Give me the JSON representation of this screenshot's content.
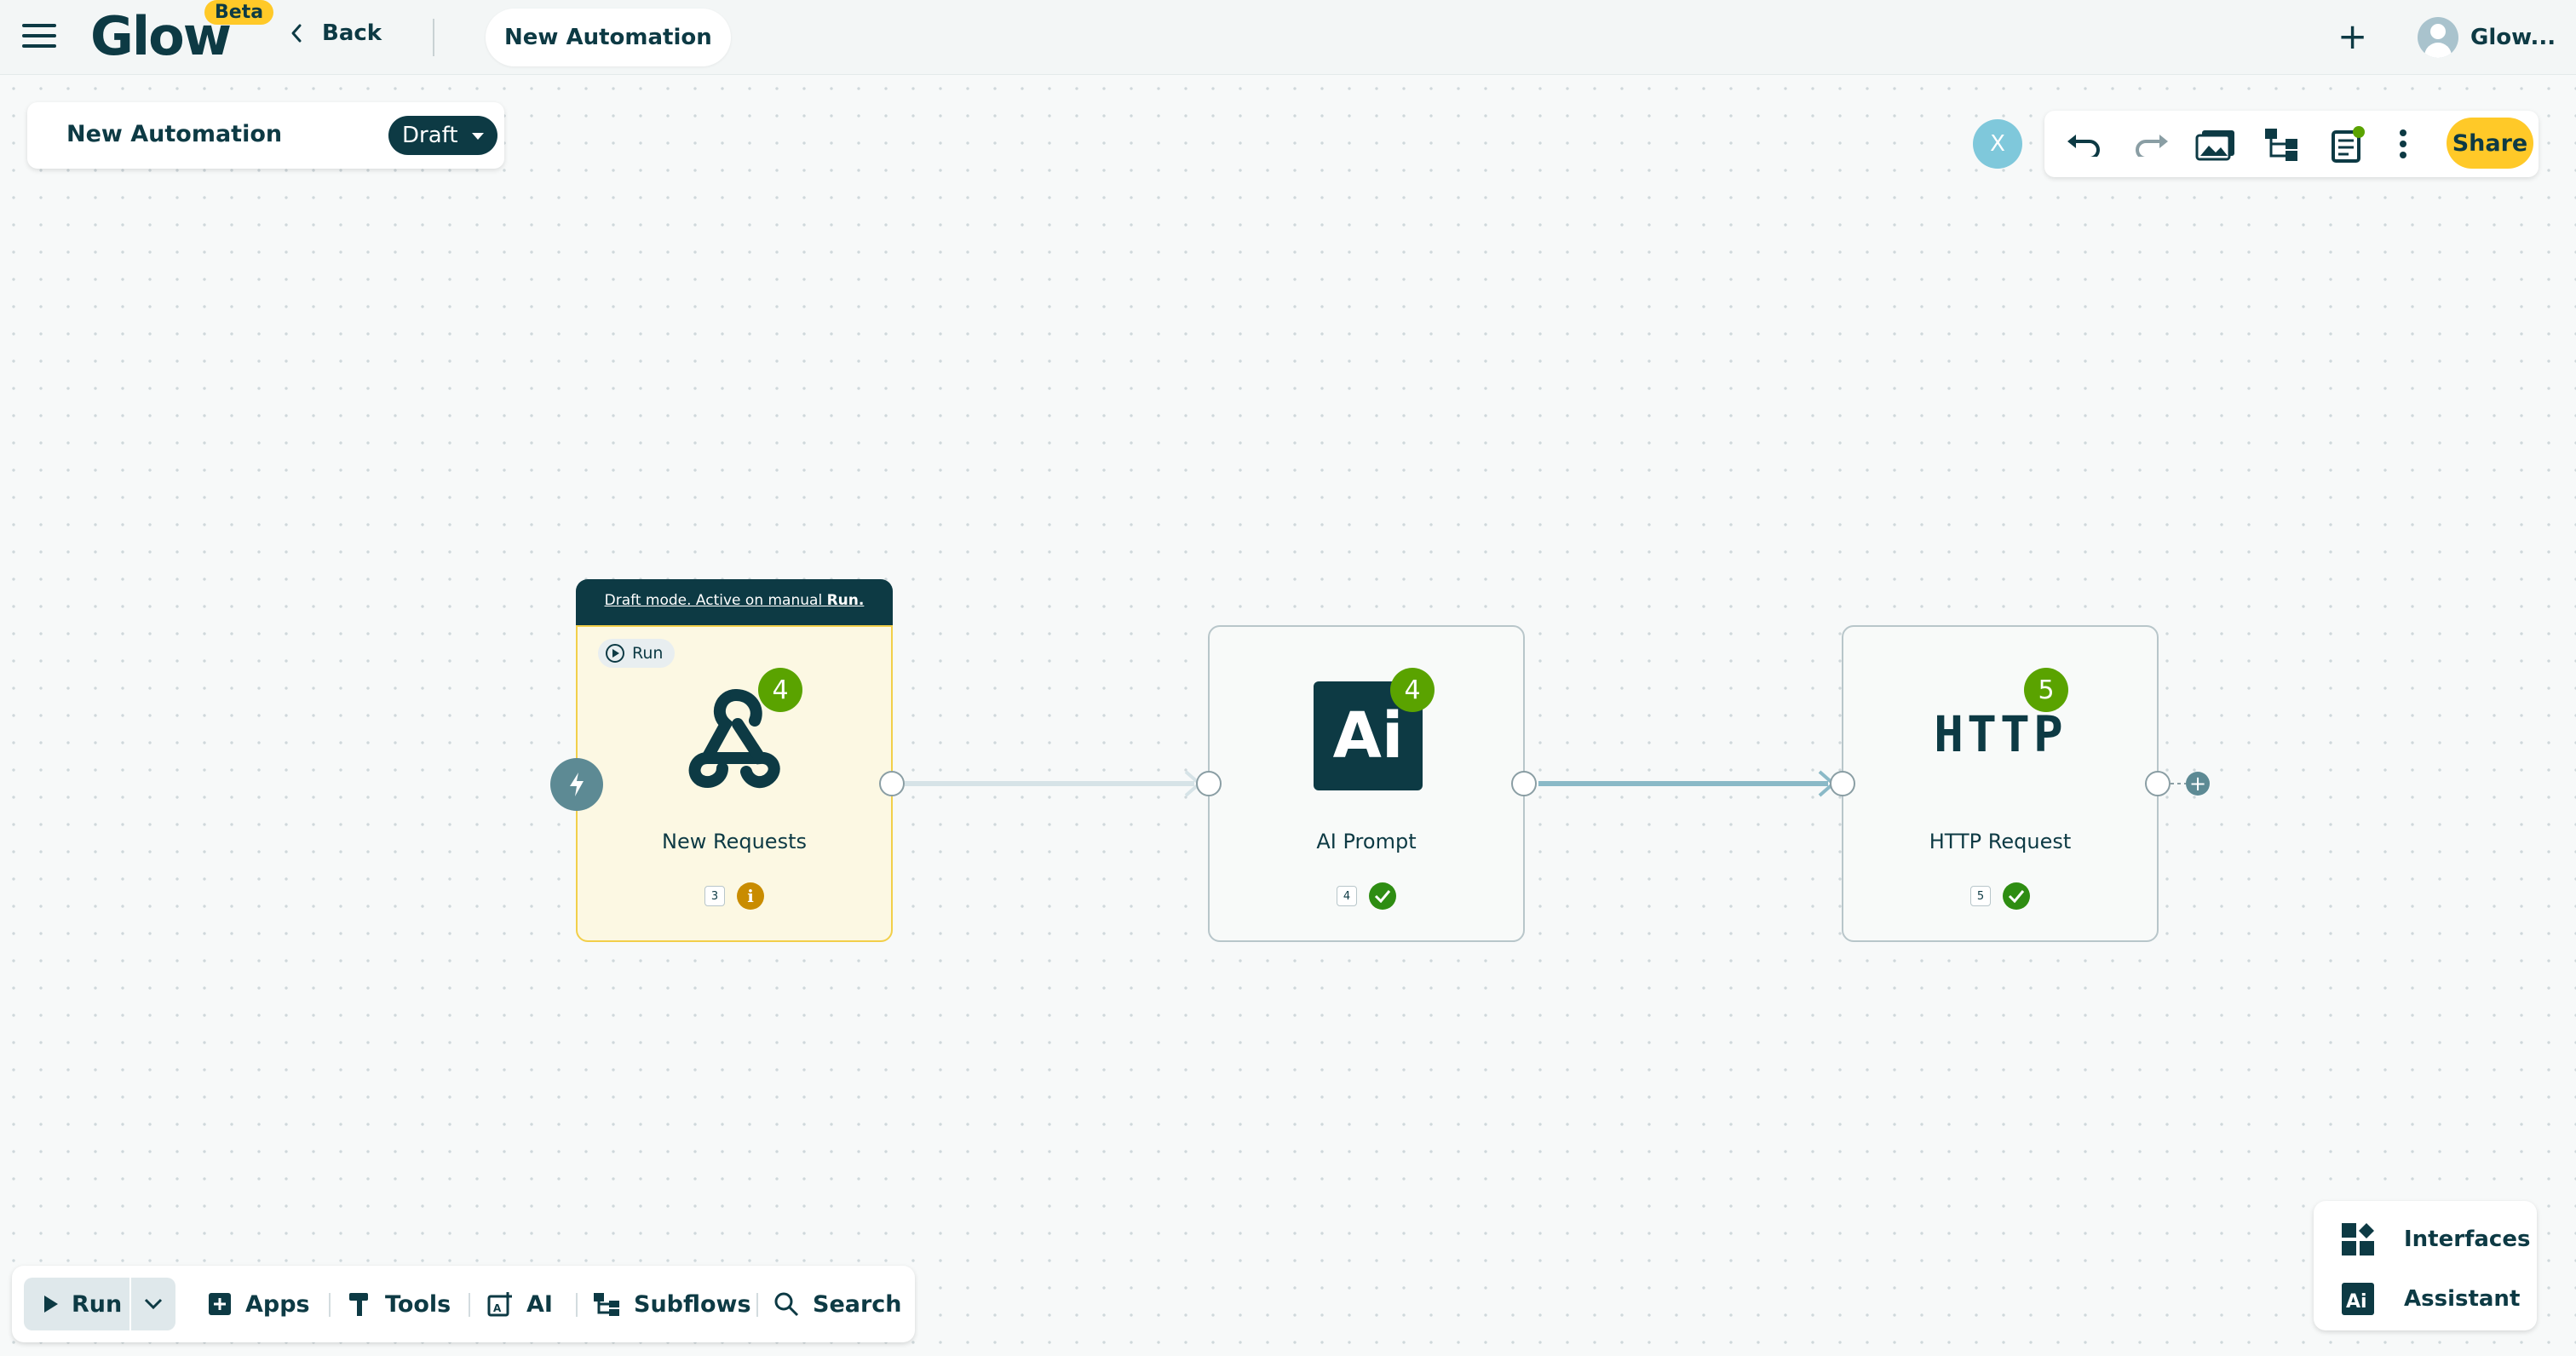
{
  "header": {
    "logo": "Glow",
    "beta": "Beta",
    "back_label": "Back",
    "tab_title": "New Automation",
    "user_name": "Glow..."
  },
  "automation": {
    "name": "New Automation",
    "status": "Draft"
  },
  "collaborator_initial": "X",
  "toolbar": {
    "share_label": "Share",
    "icons": [
      "undo-icon",
      "redo-icon",
      "gallery-icon",
      "hierarchy-icon",
      "notes-icon",
      "more-vert-icon"
    ]
  },
  "nodes": [
    {
      "label": "New Requests",
      "icon": "webhook-icon",
      "badge": "4",
      "step": "3",
      "status": "info",
      "run_label": "Run",
      "banner_prefix": "Draft mode. Active on manual ",
      "banner_bold": "Run."
    },
    {
      "label": "AI Prompt",
      "icon": "ai-icon",
      "icon_text": "Ai",
      "badge": "4",
      "step": "4",
      "status": "ok"
    },
    {
      "label": "HTTP Request",
      "icon": "http-icon",
      "icon_text": "HTTP",
      "badge": "5",
      "step": "5",
      "status": "ok"
    }
  ],
  "bottom_bar": {
    "run_label": "Run",
    "items": [
      "Apps",
      "Tools",
      "AI",
      "Subflows",
      "Search"
    ]
  },
  "side_panel": {
    "items": [
      "Interfaces",
      "Assistant"
    ]
  },
  "colors": {
    "primary": "#0d3a44",
    "accent": "#ffc928",
    "badge_green": "#5aa300",
    "trigger_bg": "#fcf8e3"
  }
}
